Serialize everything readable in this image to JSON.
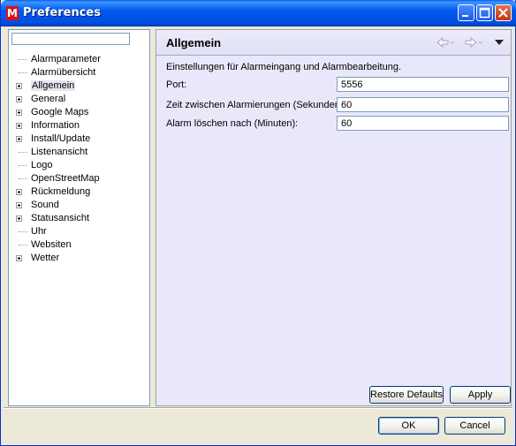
{
  "window": {
    "title": "Preferences",
    "app_icon_letter": "M",
    "buttons": [
      "minimize",
      "maximize",
      "close"
    ]
  },
  "sidebar": {
    "filter_value": "",
    "items": [
      {
        "label": "Alarmparameter",
        "expandable": false,
        "selected": false
      },
      {
        "label": "Alarmübersicht",
        "expandable": false,
        "selected": false
      },
      {
        "label": "Allgemein",
        "expandable": true,
        "selected": true
      },
      {
        "label": "General",
        "expandable": true,
        "selected": false
      },
      {
        "label": "Google Maps",
        "expandable": true,
        "selected": false
      },
      {
        "label": "Information",
        "expandable": true,
        "selected": false
      },
      {
        "label": "Install/Update",
        "expandable": true,
        "selected": false
      },
      {
        "label": "Listenansicht",
        "expandable": false,
        "selected": false
      },
      {
        "label": "Logo",
        "expandable": false,
        "selected": false
      },
      {
        "label": "OpenStreetMap",
        "expandable": false,
        "selected": false
      },
      {
        "label": "Rückmeldung",
        "expandable": true,
        "selected": false
      },
      {
        "label": "Sound",
        "expandable": true,
        "selected": false
      },
      {
        "label": "Statusansicht",
        "expandable": true,
        "selected": false
      },
      {
        "label": "Uhr",
        "expandable": false,
        "selected": false
      },
      {
        "label": "Websiten",
        "expandable": false,
        "selected": false
      },
      {
        "label": "Wetter",
        "expandable": true,
        "selected": false
      }
    ]
  },
  "page": {
    "title": "Allgemein",
    "description": "Einstellungen für Alarmeingang und Alarmbearbeitung.",
    "fields": [
      {
        "label": "Port:",
        "value": "5556"
      },
      {
        "label": "Zeit zwischen Alarmierungen (Sekunden):",
        "value": "60"
      },
      {
        "label": "Alarm löschen nach (Minuten):",
        "value": "60"
      }
    ],
    "nav_icons": [
      "back-arrow-icon",
      "forward-arrow-icon",
      "view-menu-icon"
    ],
    "restore_defaults_label": "Restore Defaults",
    "apply_label": "Apply"
  },
  "dialog": {
    "ok_label": "OK",
    "cancel_label": "Cancel"
  }
}
